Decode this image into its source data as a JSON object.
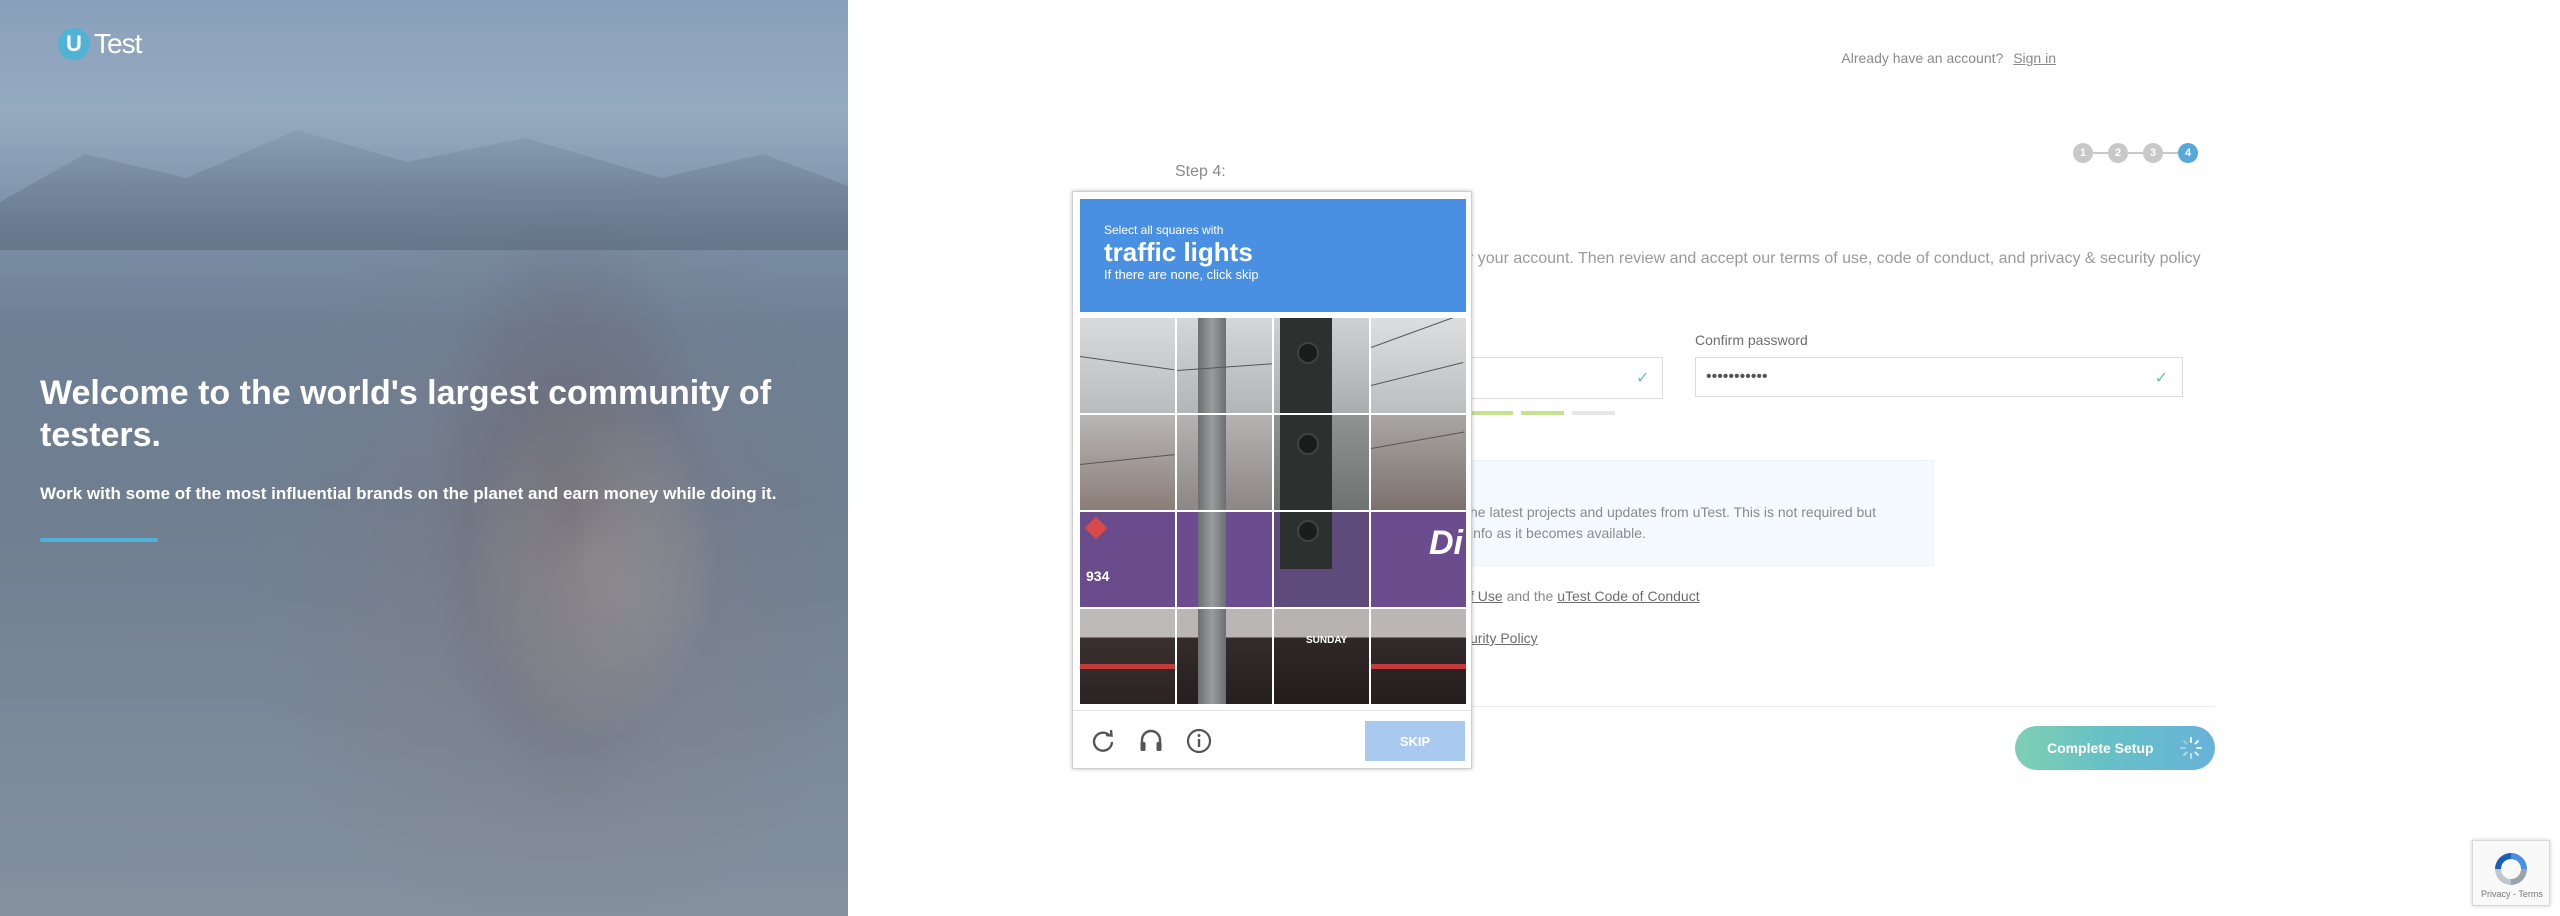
{
  "brand": {
    "badge_letter": "U",
    "name": "Test"
  },
  "hero": {
    "title": "Welcome to the world's largest community of testers.",
    "subtitle": "Work with some of the most influential brands on the planet and earn money while doing it."
  },
  "header": {
    "signin_prompt": "Already have an account?",
    "signin_link": "Sign in"
  },
  "stepper": {
    "steps": [
      "1",
      "2",
      "3",
      "4"
    ],
    "current": 4
  },
  "form": {
    "step_label": "Step 4:",
    "intro_text": "r your account. Then review and accept our terms of use, code of conduct, and privacy & security policy",
    "confirm_password_label": "Confirm password",
    "confirm_password_value": "•••••••••••",
    "strength_segments_filled": 2,
    "strength_segments_total": 3,
    "info_text": "he latest projects and updates from uTest. This is not required but info as it becomes available.",
    "agree_terms_prefix": "f Use",
    "agree_terms_mid": " and the ",
    "agree_terms_link": "uTest Code of Conduct",
    "agree_privacy_link": "urity Policy",
    "complete_button": "Complete Setup"
  },
  "captcha": {
    "instruction_small": "Select all squares with",
    "target": "traffic lights",
    "hint": "If there are none, click skip",
    "skip_button": "SKIP",
    "icons": [
      "reload-icon",
      "audio-icon",
      "info-icon"
    ],
    "tile_text": {
      "number": "934",
      "sign_letters": "Di",
      "banner_sunday": "SUNDAY"
    }
  },
  "recaptcha_badge": {
    "links": "Privacy - Terms"
  },
  "colors": {
    "accent_blue": "#4fb3d6",
    "captcha_header": "#4a90e2",
    "skip_button": "#a9c9ef",
    "check_green": "#64c7a4",
    "strength_green": "#c5e38e"
  }
}
